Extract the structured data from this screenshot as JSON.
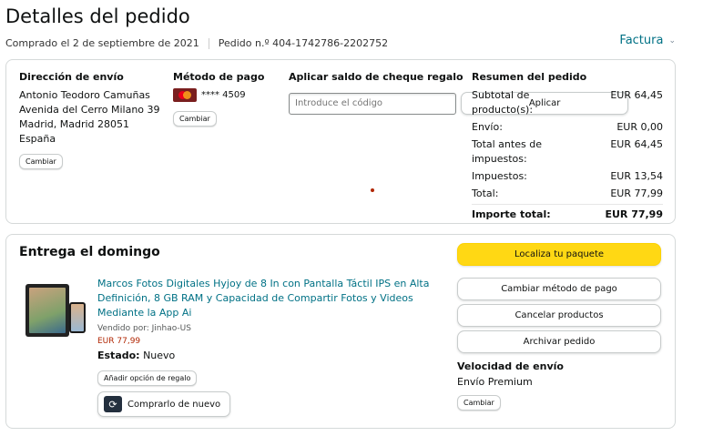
{
  "header": {
    "title": "Detalles del pedido",
    "ordered_on": "Comprado el 2 de septiembre de 2021",
    "order_number": "Pedido n.º 404-1742786-2202752",
    "invoice_label": "Factura"
  },
  "shipping": {
    "title": "Dirección de envío",
    "lines": [
      "Antonio Teodoro Camuñas",
      "Avenida del Cerro Milano 39",
      "Madrid, Madrid 28051",
      "España"
    ],
    "change_label": "Cambiar"
  },
  "payment": {
    "title": "Método de pago",
    "card_masked": "**** 4509",
    "change_label": "Cambiar"
  },
  "gift_balance": {
    "title": "Aplicar saldo de cheque regalo",
    "placeholder": "Introduce el código",
    "apply_label": "Aplicar"
  },
  "summary": {
    "title": "Resumen del pedido",
    "rows": [
      {
        "label": "Subtotal de producto(s):",
        "value": "EUR 64,45"
      },
      {
        "label": "Envío:",
        "value": "EUR 0,00"
      },
      {
        "label": "Total antes de impuestos:",
        "value": "EUR 64,45"
      },
      {
        "label": "Impuestos:",
        "value": "EUR 13,54"
      },
      {
        "label": "Total:",
        "value": "EUR 77,99"
      }
    ],
    "grand_total_label": "Importe total:",
    "grand_total_value": "EUR 77,99"
  },
  "delivery": {
    "title": "Entrega el domingo",
    "product": {
      "title": "Marcos Fotos Digitales Hyjoy de 8 In con Pantalla Táctil IPS en Alta Definición, 8 GB RAM y Capacidad de Compartir Fotos y Videos Mediante la App Ai",
      "seller": "Vendido por: Jinhao-US",
      "price": "EUR 77,99",
      "condition_label": "Estado:",
      "condition_value": "Nuevo",
      "gift_option_label": "Añadir opción de regalo",
      "rebuy_label": "Comprarlo de nuevo"
    },
    "actions": {
      "track": "Localiza tu paquete",
      "change_payment": "Cambiar método de pago",
      "cancel": "Cancelar productos",
      "archive": "Archivar pedido"
    },
    "shipping_speed_title": "Velocidad de envío",
    "shipping_speed_value": "Envío Premium",
    "shipping_speed_change": "Cambiar"
  },
  "colors": {
    "link": "#007185",
    "primary_button": "#ffd814",
    "price": "#b12704",
    "border": "#d5d9d9"
  },
  "icons": {
    "invoice_dropdown": "chevron-down-icon",
    "payment_card": "mastercard-icon",
    "rebuy": "rebuy-icon"
  }
}
